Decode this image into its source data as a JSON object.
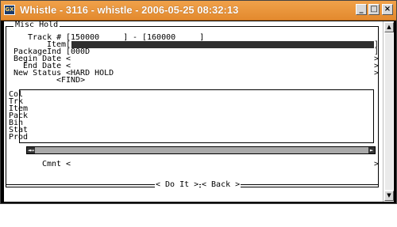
{
  "window": {
    "title": "Whistle - 3116 - whistle - 2006-05-25 08:32:13",
    "icon_text": "GX",
    "minimize_glyph": "_",
    "maximize_glyph": "□",
    "close_glyph": "×"
  },
  "form": {
    "title": "Misc Hold",
    "track": {
      "label": "Track #",
      "from": "[150000     ]",
      "dash": "-",
      "to": "[160000     ]"
    },
    "item": {
      "label": "Item",
      "open": "[",
      "close": "]"
    },
    "package_ind": {
      "label": "PackageInd",
      "value": "[000D",
      "close": "]"
    },
    "begin_date": {
      "label": "Begin Date",
      "value": "<",
      "close": ">"
    },
    "end_date": {
      "label": "End Date",
      "value": "<",
      "close": ">"
    },
    "new_status": {
      "label": "New Status",
      "value": "<HARD HOLD",
      "close": ">"
    },
    "find_button": "<FIND>",
    "columns": [
      "Col",
      "Trk",
      "Item",
      "Pack",
      "Bin",
      "Stat",
      "Prod"
    ],
    "scroll_left": "◄↔",
    "scroll_right": "►",
    "comment": {
      "label": "Cmnt",
      "value": "<",
      "close": ">"
    },
    "actions": {
      "do_it": "< Do It >",
      "back": "< Back >"
    }
  },
  "scrollbar": {
    "up": "▲",
    "down": "▼"
  }
}
